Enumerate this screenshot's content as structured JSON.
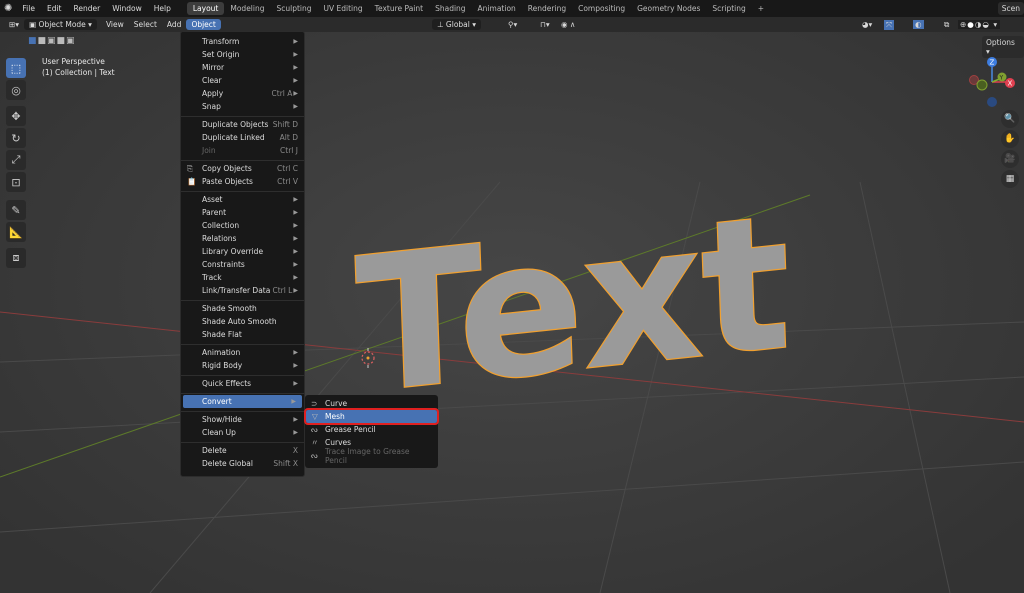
{
  "topbar": {
    "menus": [
      "File",
      "Edit",
      "Render",
      "Window",
      "Help"
    ],
    "workspaces": [
      "Layout",
      "Modeling",
      "Sculpting",
      "UV Editing",
      "Texture Paint",
      "Shading",
      "Animation",
      "Rendering",
      "Compositing",
      "Geometry Nodes",
      "Scripting"
    ],
    "active_workspace": "Layout",
    "add_tab": "+",
    "scene": "Scen"
  },
  "header": {
    "mode": "Object Mode",
    "menus": [
      "View",
      "Select",
      "Add",
      "Object"
    ],
    "active_menu": "Object",
    "orientation": "Global",
    "options": "Options"
  },
  "viewport": {
    "view_name": "User Perspective",
    "collection": "(1) Collection | Text",
    "object_text": "Text",
    "accent": "#4772b3",
    "selection_outline": "#f0a030"
  },
  "object_menu": [
    [
      {
        "label": "Transform",
        "sub": true
      },
      {
        "label": "Set Origin",
        "sub": true
      },
      {
        "label": "Mirror",
        "sub": true
      },
      {
        "label": "Clear",
        "sub": true
      },
      {
        "label": "Apply",
        "shortcut": "Ctrl A",
        "sub": true
      },
      {
        "label": "Snap",
        "sub": true
      }
    ],
    [
      {
        "label": "Duplicate Objects",
        "shortcut": "Shift D"
      },
      {
        "label": "Duplicate Linked",
        "shortcut": "Alt D"
      },
      {
        "label": "Join",
        "shortcut": "Ctrl J",
        "disabled": true
      }
    ],
    [
      {
        "label": "Copy Objects",
        "shortcut": "Ctrl C",
        "icon": "copy-icon"
      },
      {
        "label": "Paste Objects",
        "shortcut": "Ctrl V",
        "icon": "paste-icon"
      }
    ],
    [
      {
        "label": "Asset",
        "sub": true
      },
      {
        "label": "Parent",
        "sub": true
      },
      {
        "label": "Collection",
        "sub": true
      },
      {
        "label": "Relations",
        "sub": true
      },
      {
        "label": "Library Override",
        "sub": true
      },
      {
        "label": "Constraints",
        "sub": true
      },
      {
        "label": "Track",
        "sub": true
      },
      {
        "label": "Link/Transfer Data",
        "shortcut": "Ctrl L",
        "sub": true
      }
    ],
    [
      {
        "label": "Shade Smooth"
      },
      {
        "label": "Shade Auto Smooth"
      },
      {
        "label": "Shade Flat"
      }
    ],
    [
      {
        "label": "Animation",
        "sub": true
      },
      {
        "label": "Rigid Body",
        "sub": true
      }
    ],
    [
      {
        "label": "Quick Effects",
        "sub": true
      }
    ],
    [
      {
        "label": "Convert",
        "sub": true,
        "highlighted": true
      }
    ],
    [
      {
        "label": "Show/Hide",
        "sub": true
      },
      {
        "label": "Clean Up",
        "sub": true
      }
    ],
    [
      {
        "label": "Delete",
        "shortcut": "X"
      },
      {
        "label": "Delete Global",
        "shortcut": "Shift X"
      }
    ]
  ],
  "convert_menu": [
    {
      "label": "Curve",
      "icon": "curve-icon"
    },
    {
      "label": "Mesh",
      "icon": "mesh-icon",
      "highlighted": true
    },
    {
      "label": "Grease Pencil",
      "icon": "grease-pencil-icon"
    },
    {
      "label": "Curves",
      "icon": "curves-icon"
    },
    {
      "label": "Trace Image to Grease Pencil",
      "icon": "trace-icon",
      "disabled": true
    }
  ]
}
